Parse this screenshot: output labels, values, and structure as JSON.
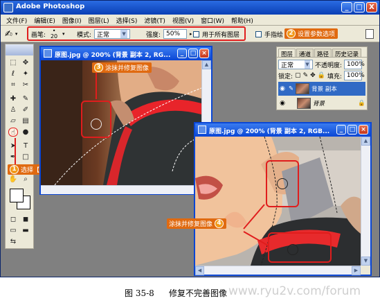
{
  "app": {
    "title": "Adobe Photoshop",
    "window_buttons": [
      "_",
      "□",
      "X"
    ]
  },
  "menubar": {
    "items": [
      "文件(F)",
      "编辑(E)",
      "图像(I)",
      "图层(L)",
      "选择(S)",
      "滤镜(T)",
      "视图(V)",
      "窗口(W)",
      "帮助(H)"
    ]
  },
  "options_bar": {
    "brush_label": "画笔:",
    "brush_size": "20",
    "mode_label": "模式:",
    "mode_value": "正常",
    "strength_label": "强度:",
    "strength_value": "50%",
    "all_layers_label": "用于所有图层",
    "finger_paint_label": "手指绘"
  },
  "callouts": {
    "c1": {
      "num": "1",
      "text": "选择【涂抹工具】"
    },
    "c2": {
      "num": "2",
      "text": "设置参数选项"
    },
    "c3": {
      "num": "3",
      "text": "涂抹并修复图像"
    },
    "c4": {
      "num": "4",
      "text": "涂抹并修复图像"
    }
  },
  "doc1": {
    "title": "原图.jpg @ 200% (背景 副本 2, RG..."
  },
  "doc2": {
    "title": "原图.jpg @ 200% (背景 副本 2, RGB..."
  },
  "layers_panel": {
    "tabs": [
      "图层",
      "通道",
      "路径",
      "历史记录"
    ],
    "blend_mode": "正常",
    "opacity_label": "不透明度:",
    "opacity_value": "100%",
    "lock_label": "锁定:",
    "fill_label": "填充:",
    "fill_value": "100%",
    "layers": [
      {
        "name": "背景 副本",
        "selected": true
      },
      {
        "name": "背景",
        "selected": false
      }
    ]
  },
  "caption": {
    "figure": "图 35-8",
    "text": "修复不完善图像",
    "watermark": "www.ryu2v.com/forum"
  },
  "colors": {
    "callout_bg": "#e06a10",
    "highlight_red": "#e01d1d",
    "titlebar_blue": "#0a46d5"
  }
}
